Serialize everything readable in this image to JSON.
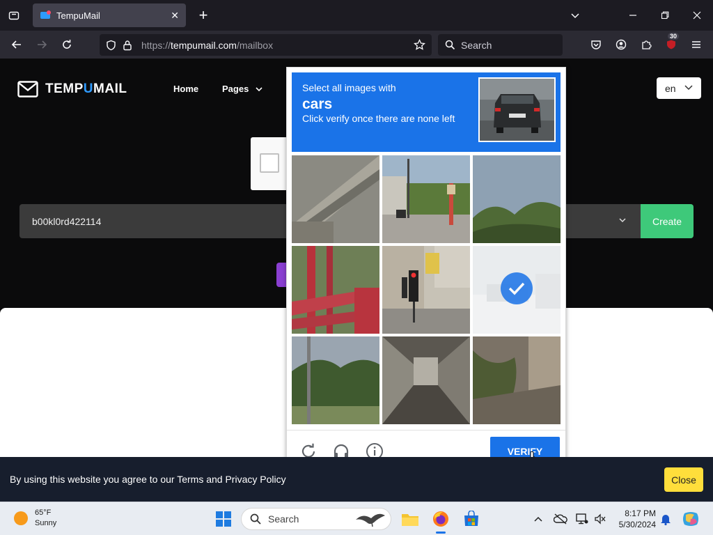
{
  "browser": {
    "tab_title": "TempuMail",
    "url_prefix": "https://",
    "url_host": "tempumail.com",
    "url_path": "/mailbox",
    "search_placeholder": "Search",
    "extension_badge": "30"
  },
  "site": {
    "logo_part1": "TEMP",
    "logo_part2": "U",
    "logo_part3": "MAIL",
    "nav": {
      "home": "Home",
      "pages": "Pages"
    },
    "language": "en",
    "email_value": "b00kl0rd422114",
    "create_label": "Create"
  },
  "captcha": {
    "prompt_line1": "Select all images with",
    "prompt_target": "cars",
    "prompt_line3": "Click verify once there are none left",
    "tiles": [
      {
        "name": "overpass",
        "selected": false
      },
      {
        "name": "street-corner",
        "selected": false
      },
      {
        "name": "sky-trees",
        "selected": false
      },
      {
        "name": "red-railing",
        "selected": false
      },
      {
        "name": "traffic-light",
        "selected": false
      },
      {
        "name": "faded-road",
        "selected": true
      },
      {
        "name": "trees-pole",
        "selected": false
      },
      {
        "name": "tunnel",
        "selected": false
      },
      {
        "name": "building-tree",
        "selected": false
      }
    ],
    "verify_label": "VERIFY"
  },
  "cookie": {
    "message": "By using this website you agree to our Terms and Privacy Policy",
    "close_label": "Close"
  },
  "taskbar": {
    "temperature": "65°F",
    "condition": "Sunny",
    "search_label": "Search",
    "time": "8:17 PM",
    "date": "5/30/2024"
  },
  "colors": {
    "captcha_blue": "#1a73e8",
    "create_green": "#3ec97a",
    "close_yellow": "#ffde3b",
    "logo_accent": "#2f9bff"
  }
}
